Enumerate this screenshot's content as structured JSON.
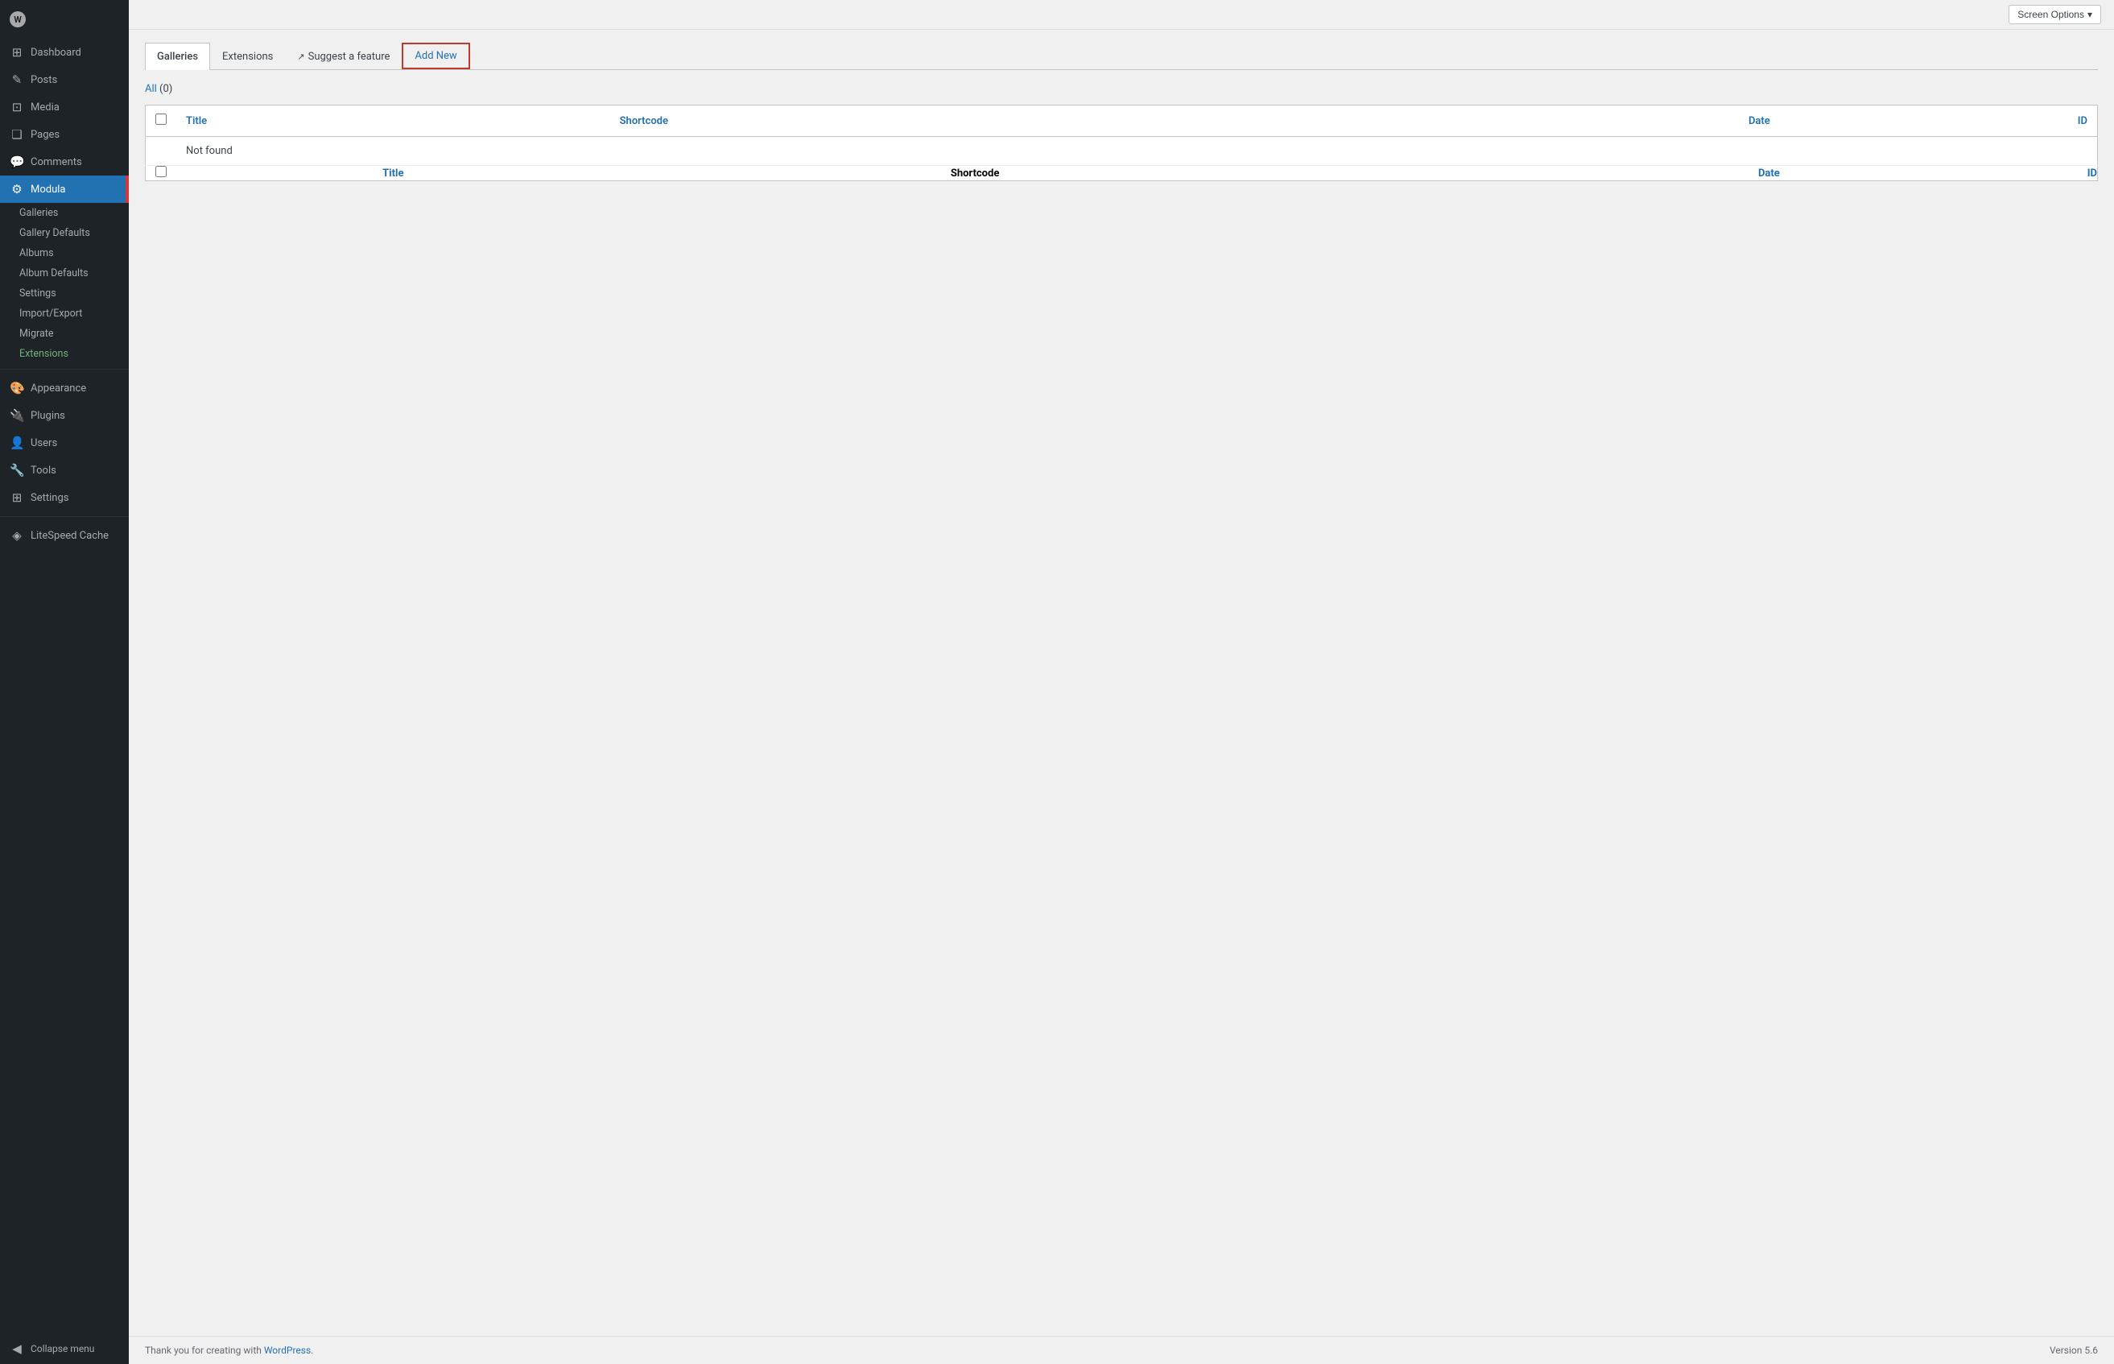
{
  "sidebar": {
    "wp_icon": "W",
    "items": [
      {
        "id": "dashboard",
        "label": "Dashboard",
        "icon": "⊞"
      },
      {
        "id": "posts",
        "label": "Posts",
        "icon": "✎"
      },
      {
        "id": "media",
        "label": "Media",
        "icon": "⊡"
      },
      {
        "id": "pages",
        "label": "Pages",
        "icon": "❏"
      },
      {
        "id": "comments",
        "label": "Comments",
        "icon": "💬"
      },
      {
        "id": "modula",
        "label": "Modula",
        "icon": "⚙",
        "active": true
      },
      {
        "id": "appearance",
        "label": "Appearance",
        "icon": "🎨"
      },
      {
        "id": "plugins",
        "label": "Plugins",
        "icon": "🔌"
      },
      {
        "id": "users",
        "label": "Users",
        "icon": "👤"
      },
      {
        "id": "tools",
        "label": "Tools",
        "icon": "🔧"
      },
      {
        "id": "settings",
        "label": "Settings",
        "icon": "⚙"
      },
      {
        "id": "litespeed",
        "label": "LiteSpeed Cache",
        "icon": "◈"
      }
    ],
    "modula_submenu": [
      {
        "id": "galleries",
        "label": "Galleries",
        "active": false
      },
      {
        "id": "gallery-defaults",
        "label": "Gallery Defaults",
        "active": false
      },
      {
        "id": "albums",
        "label": "Albums",
        "active": false
      },
      {
        "id": "album-defaults",
        "label": "Album Defaults",
        "active": false
      },
      {
        "id": "settings",
        "label": "Settings",
        "active": false
      },
      {
        "id": "import-export",
        "label": "Import/Export",
        "active": false
      },
      {
        "id": "migrate",
        "label": "Migrate",
        "active": false
      },
      {
        "id": "extensions",
        "label": "Extensions",
        "active": true,
        "green": true
      }
    ],
    "collapse_label": "Collapse menu"
  },
  "topbar": {
    "screen_options_label": "Screen Options",
    "screen_options_arrow": "▾"
  },
  "tabs": [
    {
      "id": "galleries",
      "label": "Galleries",
      "active": true
    },
    {
      "id": "extensions",
      "label": "Extensions",
      "active": false
    },
    {
      "id": "suggest",
      "label": "Suggest a feature",
      "active": false,
      "external": true
    },
    {
      "id": "add-new",
      "label": "Add New",
      "active": false,
      "highlighted": true
    }
  ],
  "filter": {
    "label": "All",
    "count": "(0)"
  },
  "table": {
    "columns": [
      {
        "id": "check",
        "label": ""
      },
      {
        "id": "title",
        "label": "Title"
      },
      {
        "id": "shortcode",
        "label": "Shortcode"
      },
      {
        "id": "date",
        "label": "Date"
      },
      {
        "id": "id",
        "label": "ID"
      }
    ],
    "rows": [],
    "empty_message": "Not found"
  },
  "footer": {
    "thank_you_text": "Thank you for creating with",
    "wp_link_label": "WordPress",
    "version_label": "Version 5.6"
  }
}
